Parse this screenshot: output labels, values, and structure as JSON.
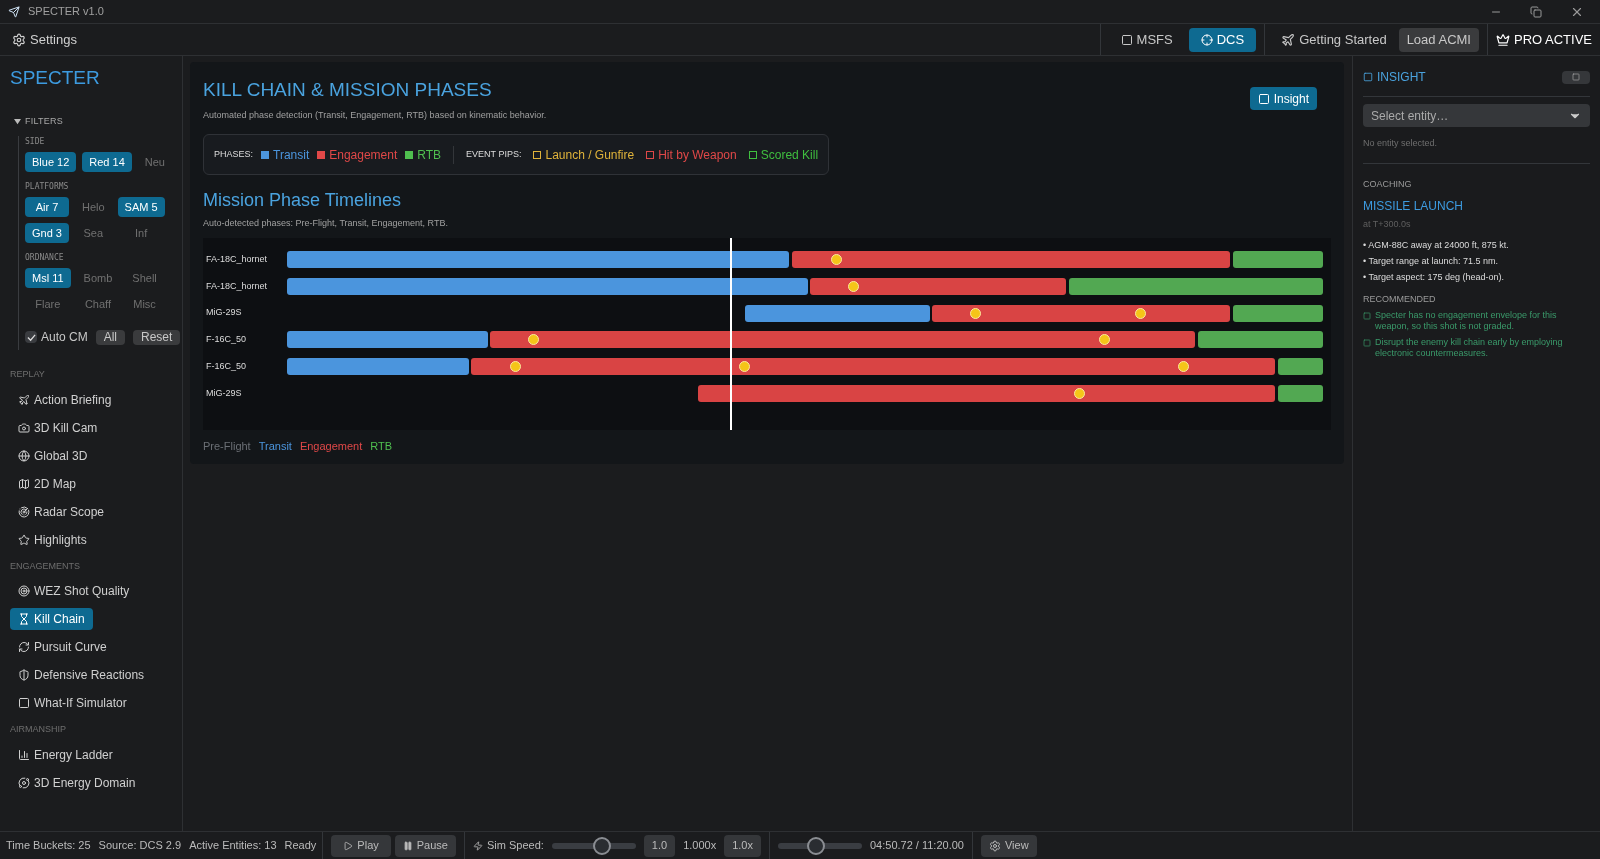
{
  "window": {
    "title": "SPECTER v1.0"
  },
  "menu_bar": {
    "settings": "Settings",
    "sim_tabs": [
      {
        "label": "MSFS",
        "selected": false
      },
      {
        "label": "DCS",
        "selected": true
      }
    ],
    "getting_started": "Getting Started",
    "load": "Load ACMI",
    "pro": "PRO ACTIVE"
  },
  "sidebar": {
    "title": "SPECTER",
    "filters": {
      "label": "FILTERS",
      "expanded": true,
      "groups": [
        {
          "label": "SIDE",
          "chips": [
            {
              "label": "Blue 12",
              "selected": true
            },
            {
              "label": "Red 14",
              "selected": true
            },
            {
              "label": "Neu",
              "selected": false
            }
          ]
        },
        {
          "label": "PLATFORMS",
          "chips": [
            {
              "label": "Air 7",
              "selected": true
            },
            {
              "label": "Helo",
              "selected": false
            },
            {
              "label": "SAM 5",
              "selected": true
            },
            {
              "label": "Gnd 3",
              "selected": true
            },
            {
              "label": "Sea",
              "selected": false
            },
            {
              "label": "Inf",
              "selected": false
            }
          ]
        },
        {
          "label": "ORDNANCE",
          "chips": [
            {
              "label": "Msl 11",
              "selected": true
            },
            {
              "label": "Bomb",
              "selected": false
            },
            {
              "label": "Shell",
              "selected": false
            },
            {
              "label": "Flare",
              "selected": false
            },
            {
              "label": "Chaff",
              "selected": false
            },
            {
              "label": "Misc",
              "selected": false
            }
          ]
        }
      ],
      "auto_cm": {
        "label": "Auto CM",
        "checked": true
      },
      "buttons": [
        "All",
        "Reset"
      ]
    },
    "sections": [
      {
        "label": "REPLAY",
        "items": [
          {
            "label": "Action Briefing",
            "selected": false
          },
          {
            "label": "3D Kill Cam",
            "selected": false
          },
          {
            "label": "Global 3D",
            "selected": false
          },
          {
            "label": "2D Map",
            "selected": false
          },
          {
            "label": "Radar Scope",
            "selected": false
          },
          {
            "label": "Highlights",
            "selected": false
          }
        ]
      },
      {
        "label": "ENGAGEMENTS",
        "items": [
          {
            "label": "WEZ Shot Quality",
            "selected": false
          },
          {
            "label": "Kill Chain",
            "selected": true
          },
          {
            "label": "Pursuit Curve",
            "selected": false
          },
          {
            "label": "Defensive Reactions",
            "selected": false
          },
          {
            "label": "What-If Simulator",
            "selected": false
          }
        ]
      },
      {
        "label": "AIRMANSHIP",
        "items": [
          {
            "label": "Energy Ladder",
            "selected": false
          },
          {
            "label": "3D Energy Domain",
            "selected": false
          }
        ]
      }
    ]
  },
  "main": {
    "title": "KILL CHAIN & MISSION PHASES",
    "subtitle": "Automated phase detection (Transit, Engagement, RTB) based on kinematic behavior.",
    "insight_button": "Insight",
    "legend": {
      "phases_label": "PHASES:",
      "phases": [
        {
          "label": "Transit",
          "color": "#4b95dd"
        },
        {
          "label": "Engagement",
          "color": "#e04848"
        },
        {
          "label": "RTB",
          "color": "#4fbf4f"
        }
      ],
      "pips_label": "EVENT PIPS:",
      "pips": [
        {
          "label": "Launch / Gunfire",
          "color": "#e0b33a"
        },
        {
          "label": "Hit by Weapon",
          "color": "#e04848"
        },
        {
          "label": "Scored Kill",
          "color": "#3fbf3f"
        }
      ]
    },
    "timelines": {
      "title": "Mission Phase Timelines",
      "subtitle": "Auto-detected phases: Pre-Flight, Transit, Engagement, RTB.",
      "rows": [
        {
          "label": "FA-18C_hornet",
          "segments": [
            {
              "kind": "transit"
            },
            {
              "kind": "engagement"
            },
            {
              "kind": "rtb"
            }
          ]
        },
        {
          "label": "FA-18C_hornet",
          "segments": [
            {
              "kind": "transit"
            },
            {
              "kind": "engagement"
            },
            {
              "kind": "rtb"
            }
          ]
        },
        {
          "label": "MiG-29S",
          "segments": [
            {
              "kind": "transit"
            },
            {
              "kind": "engagement"
            },
            {
              "kind": "rtb"
            }
          ]
        },
        {
          "label": "F-16C_50",
          "segments": [
            {
              "kind": "transit"
            },
            {
              "kind": "engagement"
            },
            {
              "kind": "rtb"
            }
          ]
        },
        {
          "label": "F-16C_50",
          "segments": [
            {
              "kind": "transit"
            },
            {
              "kind": "engagement"
            },
            {
              "kind": "rtb"
            }
          ]
        },
        {
          "label": "MiG-29S",
          "segments": [
            {
              "kind": "engagement"
            },
            {
              "kind": "rtb"
            }
          ]
        }
      ],
      "footer": [
        {
          "label": "Pre-Flight",
          "color": "#6b6f75"
        },
        {
          "label": "Transit",
          "color": "#4b95dd"
        },
        {
          "label": "Engagement",
          "color": "#e04848"
        },
        {
          "label": "RTB",
          "color": "#4fbf4f"
        }
      ]
    }
  },
  "insight": {
    "title": "INSIGHT",
    "select": {
      "placeholder": "Select entity…"
    },
    "status": "No entity selected.",
    "coaching": {
      "label": "COACHING",
      "title": "MISSILE LAUNCH",
      "time": "at T+300.0s",
      "bullets": [
        "• AGM-88C away at 24000 ft, 875 kt.",
        "• Target range at launch: 71.5 nm.",
        "• Target aspect: 175 deg (head-on)."
      ]
    },
    "recommended": {
      "label": "RECOMMENDED",
      "items": [
        "Specter has no engagement envelope for this weapon, so this shot is not graded.",
        "Disrupt the enemy kill chain early by employing electronic countermeasures."
      ]
    }
  },
  "status_bar": {
    "info": [
      "Time Buckets: 25",
      "Source: DCS 2.9",
      "Active Entities: 13",
      "Ready"
    ],
    "play": "Play",
    "pause": "Pause",
    "sim_speed": {
      "label": "Sim Speed:",
      "level": 0.6,
      "value": "1.0",
      "reading": "1.000x",
      "preset": "1.0x"
    },
    "scrubber": {
      "level": 0.45,
      "time": "04:50.72 / 11:20.00"
    },
    "view": "View"
  }
}
